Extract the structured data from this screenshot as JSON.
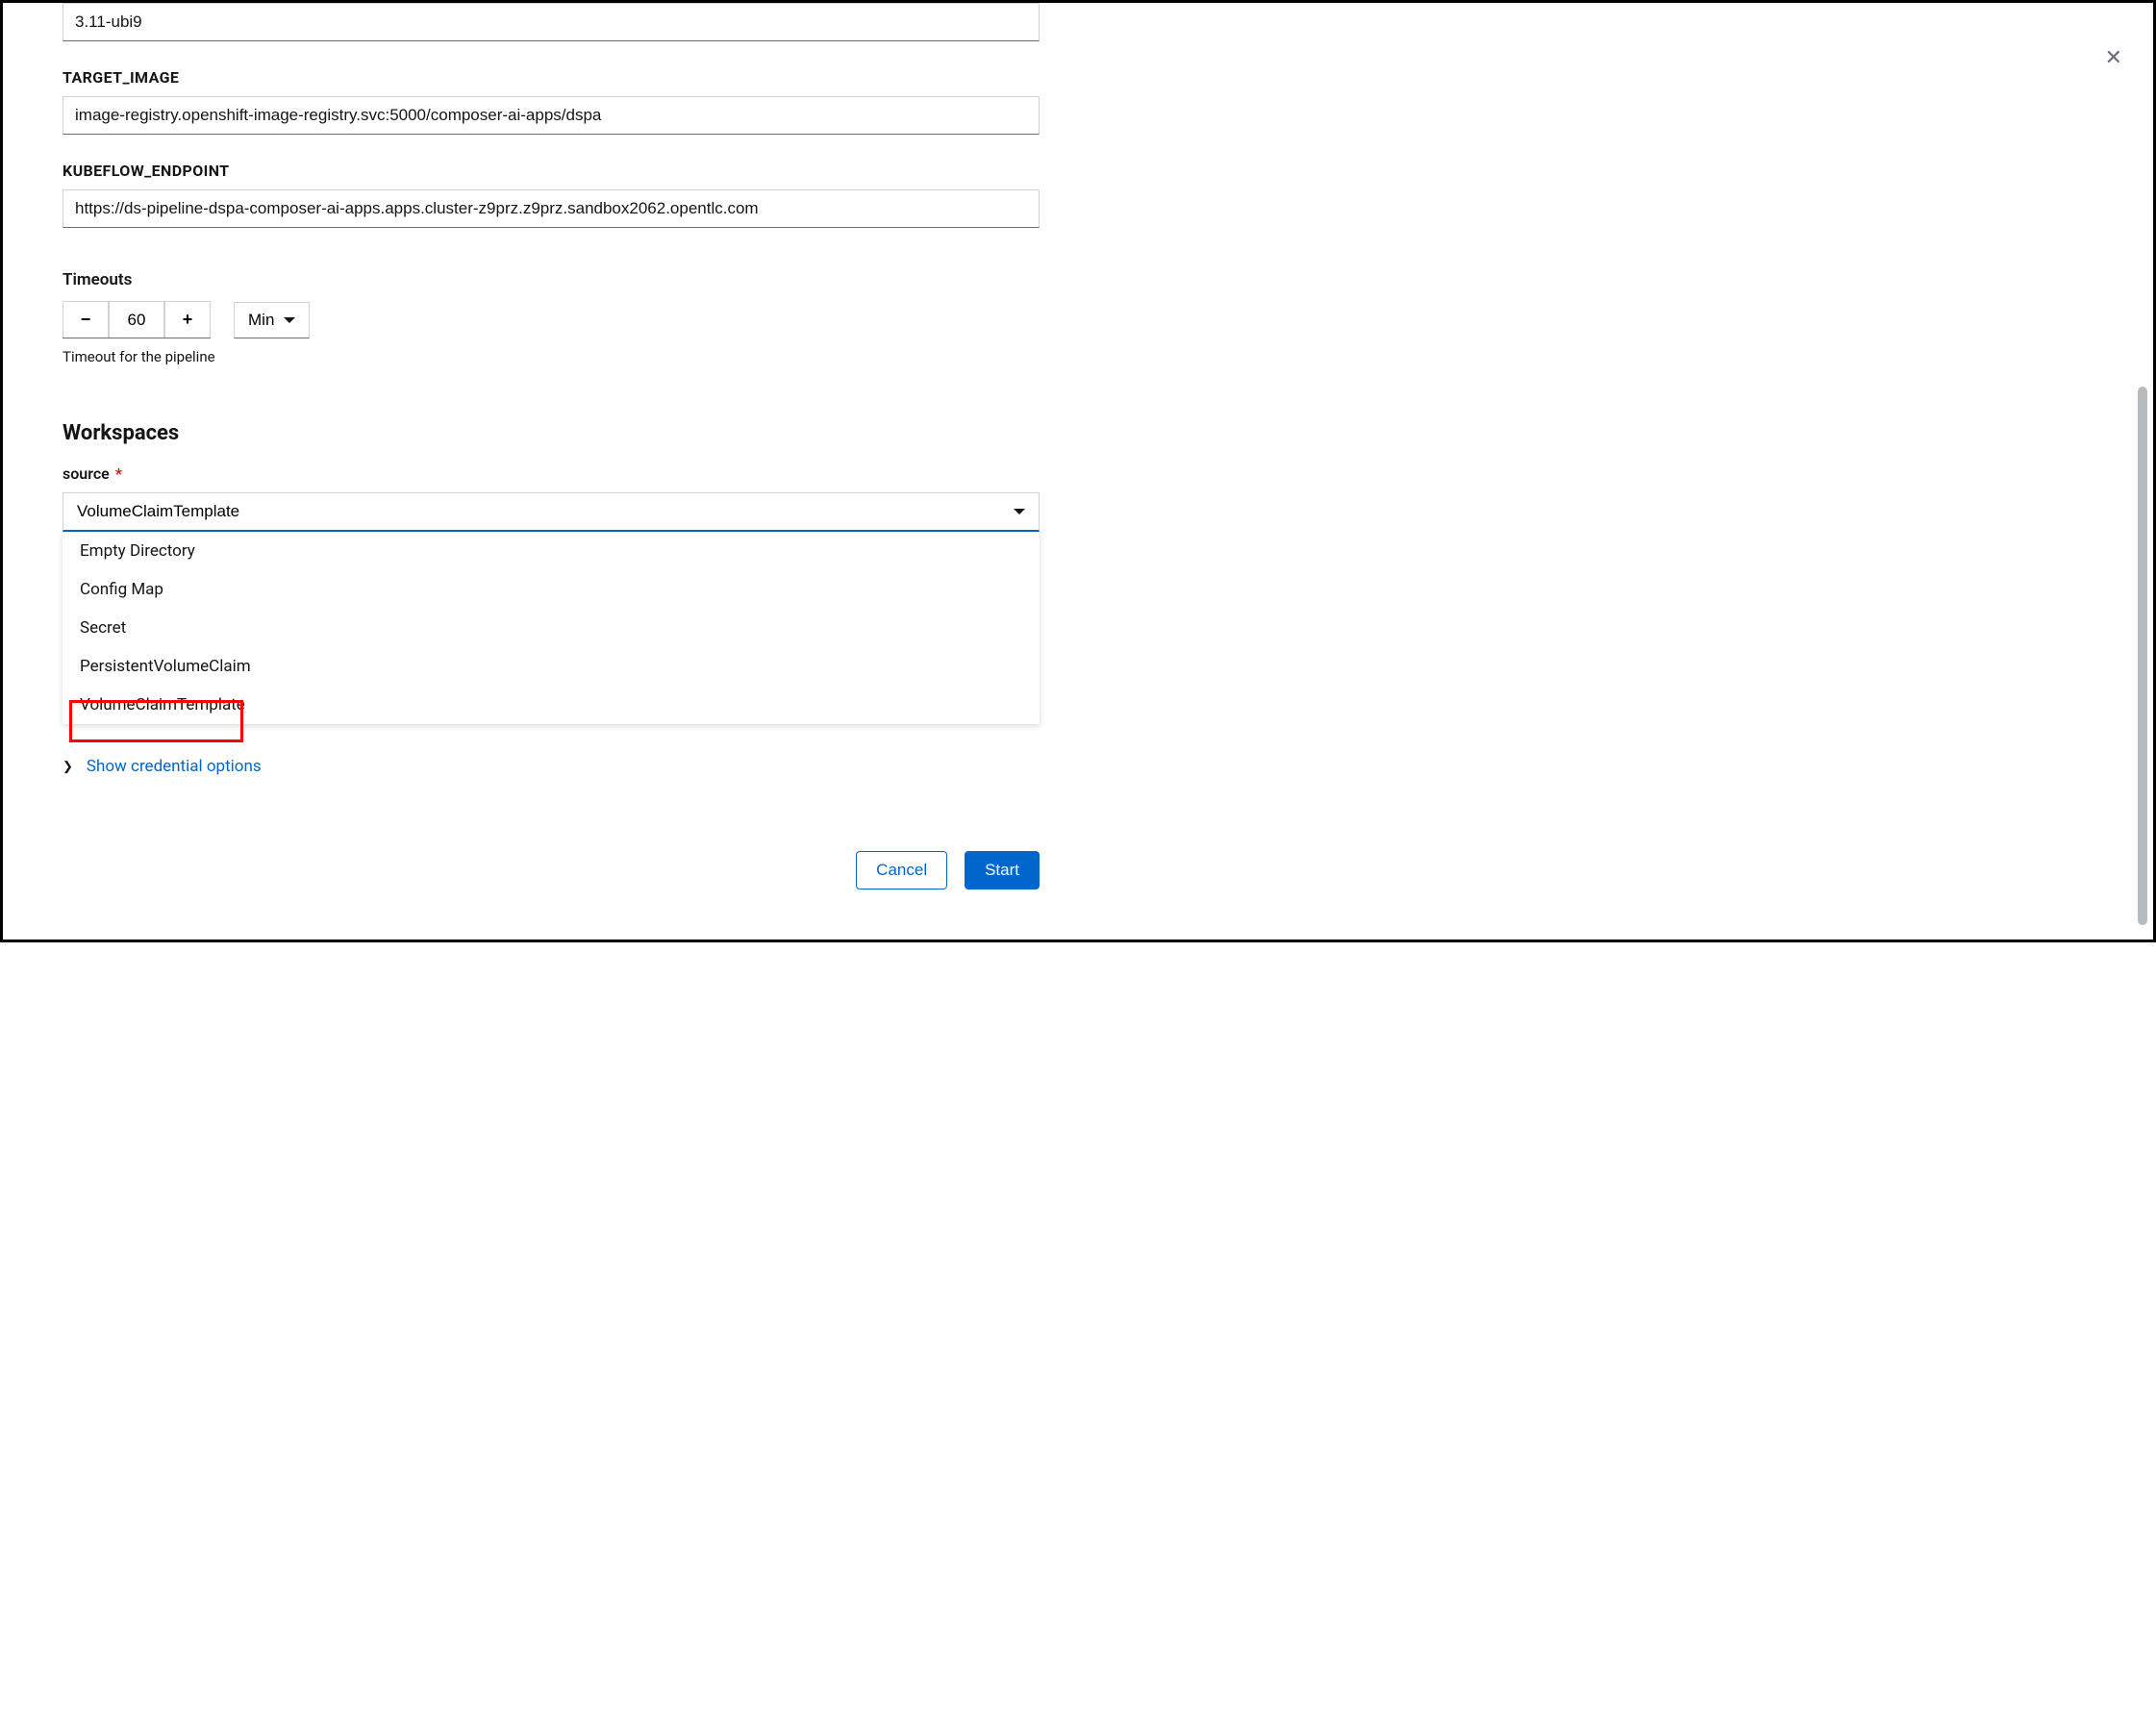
{
  "fields": {
    "first_input_value": "3.11-ubi9",
    "target_image_label": "TARGET_IMAGE",
    "target_image_value": "image-registry.openshift-image-registry.svc:5000/composer-ai-apps/dspa",
    "kubeflow_endpoint_label": "KUBEFLOW_ENDPOINT",
    "kubeflow_endpoint_value": "https://ds-pipeline-dspa-composer-ai-apps.apps.cluster-z9prz.z9prz.sandbox2062.opentlc.com"
  },
  "timeouts": {
    "label": "Timeouts",
    "value": "60",
    "unit": "Min",
    "helper": "Timeout for the pipeline"
  },
  "workspaces": {
    "heading": "Workspaces",
    "source_label": "source",
    "selected": "VolumeClaimTemplate",
    "options": [
      "Empty Directory",
      "Config Map",
      "Secret",
      "PersistentVolumeClaim",
      "VolumeClaimTemplate"
    ],
    "credential_link": "Show credential options"
  },
  "actions": {
    "cancel": "Cancel",
    "start": "Start"
  }
}
